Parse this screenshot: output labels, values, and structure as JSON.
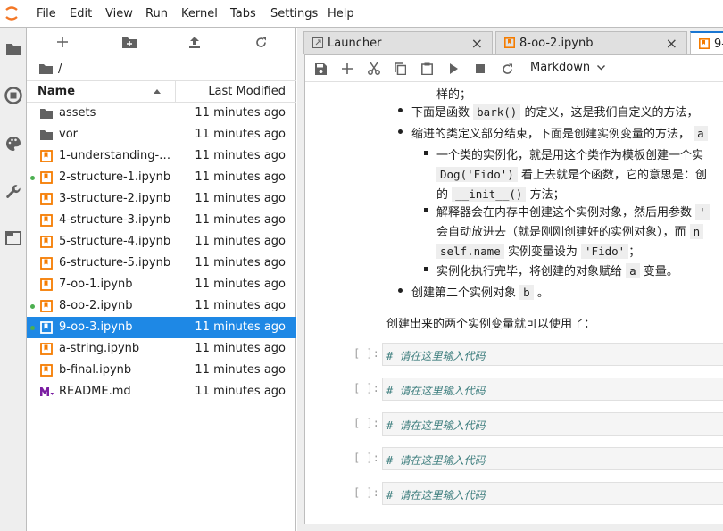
{
  "menu": [
    "File",
    "Edit",
    "View",
    "Run",
    "Kernel",
    "Tabs",
    "Settings",
    "Help"
  ],
  "icons": {
    "left_sidebar": [
      "folder-icon",
      "stop-circle-icon",
      "palette-icon",
      "wrench-icon",
      "tab-icon"
    ],
    "file_toolbar": [
      "new-launcher-icon",
      "new-folder-icon",
      "upload-icon",
      "refresh-icon"
    ],
    "notebook_toolbar": [
      "save-icon",
      "insert-cell-icon",
      "cut-icon",
      "copy-icon",
      "paste-icon",
      "run-icon",
      "stop-icon",
      "restart-icon"
    ]
  },
  "breadcrumb": "/",
  "file_list": {
    "headers": {
      "name": "Name",
      "modified": "Last Modified"
    },
    "rows": [
      {
        "name": "assets",
        "type": "folder",
        "modified": "11 minutes ago"
      },
      {
        "name": "vor",
        "type": "folder",
        "modified": "11 minutes ago"
      },
      {
        "name": "1-understanding-pr...",
        "type": "notebook",
        "modified": "11 minutes ago"
      },
      {
        "name": "2-structure-1.ipynb",
        "type": "notebook",
        "modified": "11 minutes ago",
        "running": true
      },
      {
        "name": "3-structure-2.ipynb",
        "type": "notebook",
        "modified": "11 minutes ago"
      },
      {
        "name": "4-structure-3.ipynb",
        "type": "notebook",
        "modified": "11 minutes ago"
      },
      {
        "name": "5-structure-4.ipynb",
        "type": "notebook",
        "modified": "11 minutes ago"
      },
      {
        "name": "6-structure-5.ipynb",
        "type": "notebook",
        "modified": "11 minutes ago"
      },
      {
        "name": "7-oo-1.ipynb",
        "type": "notebook",
        "modified": "11 minutes ago"
      },
      {
        "name": "8-oo-2.ipynb",
        "type": "notebook",
        "modified": "11 minutes ago",
        "running": true
      },
      {
        "name": "9-oo-3.ipynb",
        "type": "notebook",
        "modified": "11 minutes ago",
        "running": true,
        "selected": true
      },
      {
        "name": "a-string.ipynb",
        "type": "notebook",
        "modified": "11 minutes ago"
      },
      {
        "name": "b-final.ipynb",
        "type": "notebook",
        "modified": "11 minutes ago"
      },
      {
        "name": "README.md",
        "type": "markdown",
        "modified": "11 minutes ago"
      }
    ]
  },
  "tabs": [
    {
      "label": "Launcher",
      "close": "×"
    },
    {
      "label": "8-oo-2.ipynb",
      "close": "×"
    },
    {
      "label": "9-",
      "close": ""
    }
  ],
  "notebook": {
    "cell_type": "Markdown",
    "text": {
      "l1": "样的；",
      "l2a": "下面是函数",
      "l2code": "bark()",
      "l2b": "的定义，这是我们自定义的方法，",
      "l3a": "缩进的类定义部分结束，下面是创建实例变量的方法，",
      "l3code": "a",
      "l4": "一个类的实例化，就是用这个类作为模板创建一个实",
      "l5code": "Dog('Fido')",
      "l5b": "看上去就是个函数，它的意思是：创",
      "l6a": "的",
      "l6code": "__init__()",
      "l6b": "方法；",
      "l7a": "解释器会在内存中创建这个实例对象，然后用参数",
      "l7code": "'",
      "l8a": "会自动放进去（就是刚刚创建好的实例对象），而",
      "l8code": "n",
      "l9code1": "self.name",
      "l9b": "实例变量设为",
      "l9code2": "'Fido'",
      "l9c": "；",
      "l10a": "实例化执行完毕，将创建的对象赋给",
      "l10code": "a",
      "l10b": "变量。",
      "l11a": "创建第二个实例对象",
      "l11code": "b",
      "l11b": "。",
      "l12": "创建出来的两个实例变量就可以使用了："
    },
    "cells": [
      {
        "prompt": "[ ]:",
        "code": "# 请在这里输入代码"
      },
      {
        "prompt": "[ ]:",
        "code": "# 请在这里输入代码"
      },
      {
        "prompt": "[ ]:",
        "code": "# 请在这里输入代码"
      },
      {
        "prompt": "[ ]:",
        "code": "# 请在这里输入代码"
      },
      {
        "prompt": "[ ]:",
        "code": "# 请在这里输入代码"
      }
    ]
  },
  "colors": {
    "accent": "#1e88e5",
    "notebook_icon": "#f57c00",
    "markdown_icon": "#7b1fa2",
    "running_dot": "#4caf50"
  }
}
